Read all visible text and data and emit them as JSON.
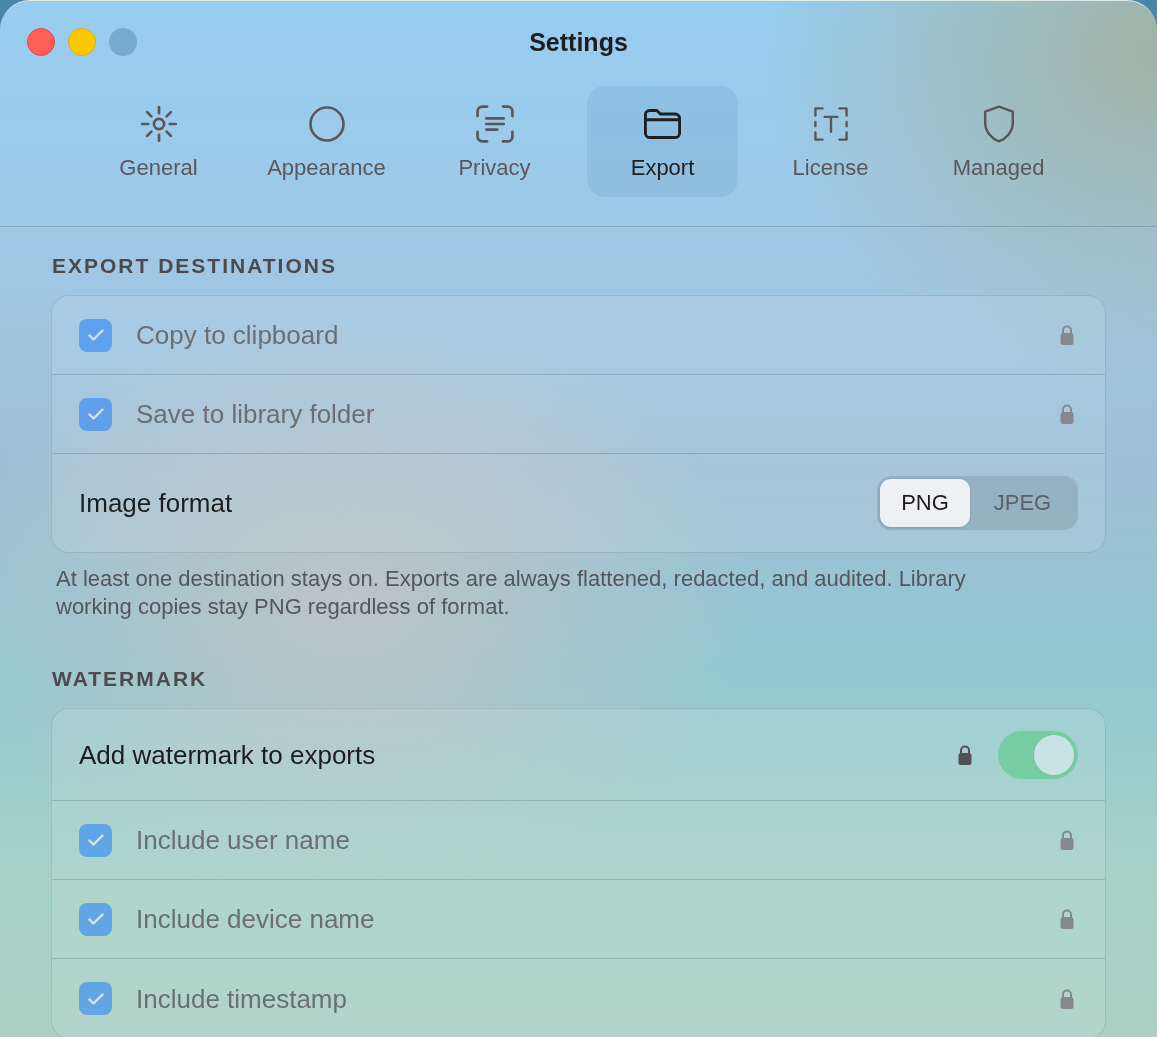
{
  "window": {
    "title": "Settings",
    "controls": [
      {
        "kind": "close",
        "disabled": false
      },
      {
        "kind": "minimize",
        "disabled": false
      },
      {
        "kind": "zoom",
        "disabled": true
      }
    ]
  },
  "tabs": [
    {
      "label": "General",
      "selected": false
    },
    {
      "label": "Appearance",
      "selected": false
    },
    {
      "label": "Privacy",
      "selected": false
    },
    {
      "label": "Export",
      "selected": true
    },
    {
      "label": "License",
      "selected": false
    },
    {
      "label": "Managed",
      "selected": false
    }
  ],
  "sections": [
    {
      "heading": "EXPORT DESTINATIONS",
      "rows": [
        {
          "kind": "checkbox",
          "label": "Copy to clipboard",
          "checked": true,
          "disabled": true,
          "locked": true
        },
        {
          "kind": "checkbox",
          "label": "Save to library folder",
          "checked": true,
          "disabled": true,
          "locked": true
        },
        {
          "kind": "segmented",
          "label": "Image format",
          "options": [
            {
              "label": "PNG",
              "selected": true
            },
            {
              "label": "JPEG",
              "selected": false
            }
          ]
        }
      ],
      "footnote": "At least one destination stays on. Exports are always flattened, redacted, and audited. Library working copies stay PNG regardless of format."
    },
    {
      "heading": "WATERMARK",
      "rows": [
        {
          "kind": "toggle",
          "label": "Add watermark to exports",
          "on": true,
          "disabled": true,
          "locked": true
        },
        {
          "kind": "checkbox",
          "label": "Include user name",
          "checked": true,
          "disabled": true,
          "locked": true
        },
        {
          "kind": "checkbox",
          "label": "Include device name",
          "checked": true,
          "disabled": true,
          "locked": true
        },
        {
          "kind": "checkbox",
          "label": "Include timestamp",
          "checked": true,
          "disabled": true,
          "locked": true
        }
      ]
    }
  ]
}
